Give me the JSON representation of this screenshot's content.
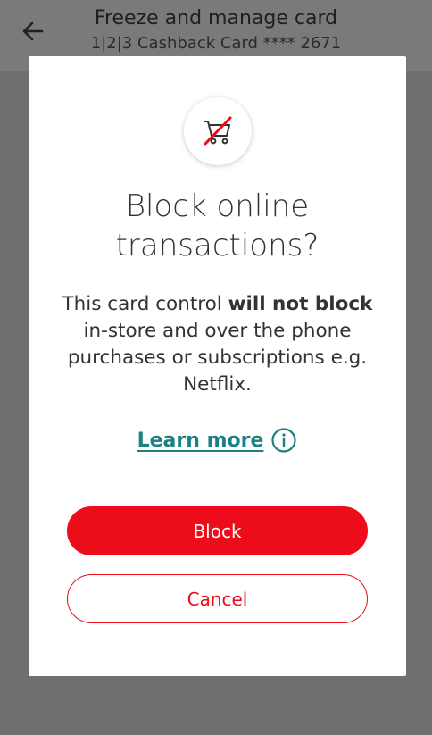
{
  "header": {
    "title": "Freeze and manage card",
    "subtitle": "1|2|3 Cashback Card  **** 2671",
    "back_icon": "arrow-left-icon"
  },
  "dialog": {
    "icon": "cart-blocked-icon",
    "title_line1": "Block online",
    "title_line2": "transactions?",
    "body_part1": "This card control ",
    "body_bold": "will not block",
    "body_part2": " in-store and over the phone purchases or subscriptions e.g. Netflix.",
    "learn_more": "Learn more",
    "learn_more_icon": "info-circle-icon",
    "block_button": "Block",
    "cancel_button": "Cancel"
  },
  "colors": {
    "accent_red": "#ec0c1a",
    "link_teal": "#1d8083",
    "overlay": "#6f6f6f"
  }
}
